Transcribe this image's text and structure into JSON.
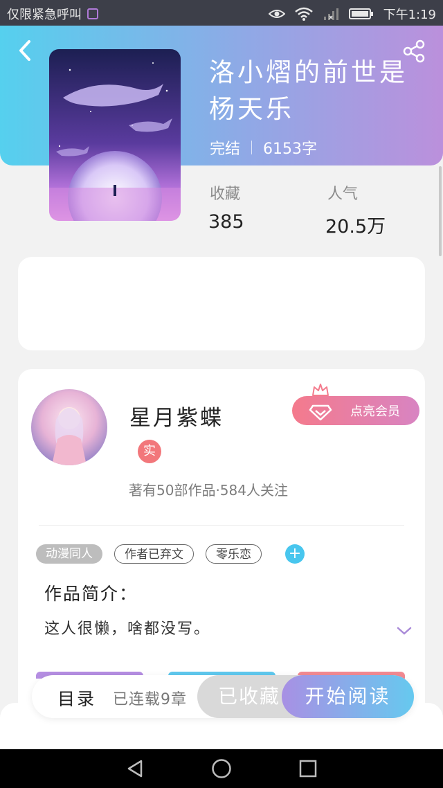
{
  "status_bar": {
    "carrier_text": "仅限紧急呼叫",
    "time": "下午1:19",
    "icons": [
      "picture-icon",
      "eye-comfort-icon",
      "wifi-icon",
      "signal-icon",
      "battery-icon"
    ]
  },
  "header": {
    "back_icon": "back-arrow-icon",
    "share_icon": "share-icon",
    "book_title": "洛小熠的前世是杨天乐",
    "status": "完结",
    "word_count": "6153字",
    "stats": [
      {
        "label": "收藏",
        "value": "385"
      },
      {
        "label": "人气",
        "value": "20.5万"
      }
    ]
  },
  "author": {
    "name": "星月紫蝶",
    "verified_badge": "实",
    "vip_button": "点亮会员",
    "meta": "著有50部作品·584人关注"
  },
  "tags": [
    {
      "label": "动漫同人",
      "style": "filled"
    },
    {
      "label": "作者已弃文",
      "style": "outline"
    },
    {
      "label": "零乐恋",
      "style": "outline"
    }
  ],
  "tag_add_icon": "plus-icon",
  "intro": {
    "title": "作品简介：",
    "text": "这人很懒，啥都没写。",
    "expand_icon": "chevron-down-icon"
  },
  "bottom_bar": {
    "catalog_label": "目录",
    "serial_status": "已连载9章",
    "collected_label": "已收藏",
    "read_label": "开始阅读"
  },
  "nav_bar": {
    "icons": [
      "nav-back-icon",
      "nav-home-icon",
      "nav-recent-icon"
    ]
  },
  "colors": {
    "header_gradient_start": "#55d0ee",
    "header_gradient_end": "#bb90dc",
    "accent_blue": "#48c6ee",
    "vip_pink": "#f47a8c",
    "read_gradient_start": "#a890e4",
    "read_gradient_end": "#66c9ef"
  }
}
